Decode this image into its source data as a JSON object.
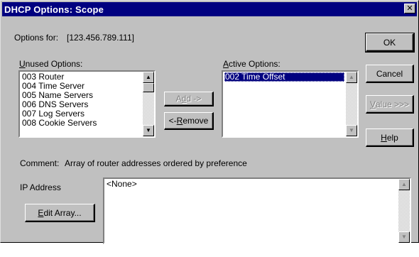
{
  "window": {
    "title": "DHCP Options: Scope"
  },
  "options_for": {
    "label": "Options for:",
    "value": "[123.456.789.111]"
  },
  "unused": {
    "label_mnemonic": "U",
    "label_rest": "nused Options:",
    "items": [
      "003 Router",
      "004 Time Server",
      "005 Name Servers",
      "006 DNS Servers",
      "007 Log Servers",
      "008 Cookie Servers"
    ]
  },
  "active": {
    "label_mnemonic": "A",
    "label_rest": "ctive Options:",
    "items": [
      "002 Time Offset"
    ]
  },
  "buttons": {
    "ok": "OK",
    "cancel": "Cancel",
    "value_mnemonic": "V",
    "value_rest": "alue >>>",
    "help_mnemonic": "H",
    "help_rest": "elp",
    "add_pre": "A",
    "add_mnemonic": "d",
    "add_rest": "d ->",
    "remove_pre": "<- ",
    "remove_mnemonic": "R",
    "remove_rest": "emove"
  },
  "comment": {
    "label": "Comment:",
    "text": "Array of router addresses ordered by preference"
  },
  "ip": {
    "label": "IP Address",
    "value": "<None>",
    "edit_mnemonic": "E",
    "edit_rest": "dit Array..."
  }
}
